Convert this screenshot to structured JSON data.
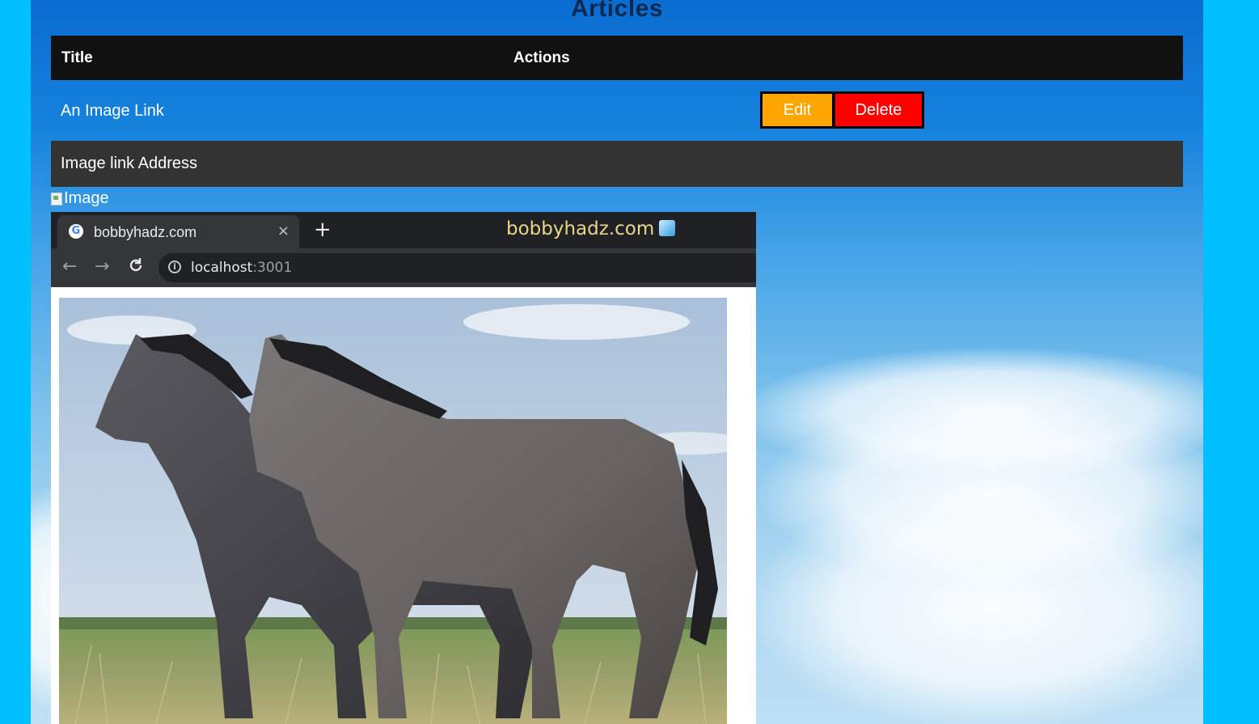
{
  "page": {
    "heading": "Articles"
  },
  "table": {
    "headers": [
      "Title",
      "Actions"
    ],
    "rows": [
      {
        "title": "An Image Link",
        "edit_label": "Edit",
        "delete_label": "Delete"
      }
    ],
    "detail_label": "Image link Address",
    "broken_image_alt": "Image"
  },
  "embedded_screenshot": {
    "tab_title": "bobbyhadz.com",
    "tab_close": "×",
    "new_tab": "+",
    "watermark": "bobbyhadz.com",
    "url_host": "localhost",
    "url_port": ":3001",
    "nav_back": "←",
    "nav_forward": "→",
    "nav_reload": "C",
    "info_icon": "i",
    "google_icon": "G"
  },
  "colors": {
    "outer_background": "#00c0ff",
    "header_bg": "#111111",
    "detail_bg": "#333333",
    "edit_button": "#ffa500",
    "delete_button": "#ff0000"
  }
}
